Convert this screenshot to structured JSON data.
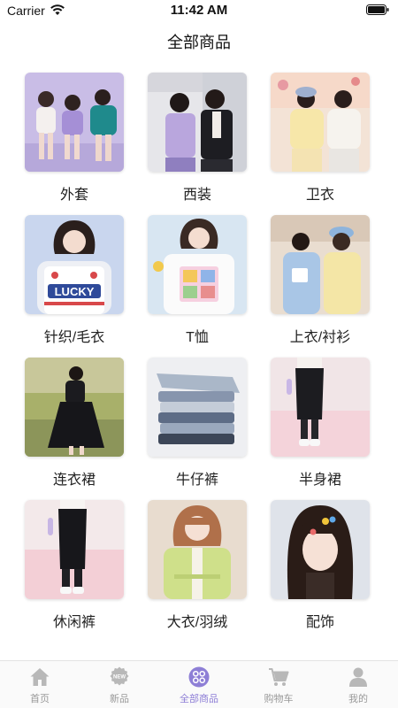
{
  "status": {
    "carrier": "Carrier",
    "time": "11:42 AM"
  },
  "nav": {
    "title": "全部商品"
  },
  "categories": [
    {
      "label": "外套",
      "icon": "photo-outerwear"
    },
    {
      "label": "西装",
      "icon": "photo-suit"
    },
    {
      "label": "卫衣",
      "icon": "photo-hoodie"
    },
    {
      "label": "针织/毛衣",
      "icon": "photo-knitwear",
      "photo_text": "LUCKY"
    },
    {
      "label": "T恤",
      "icon": "photo-tshirt"
    },
    {
      "label": "上衣/衬衫",
      "icon": "photo-shirt"
    },
    {
      "label": "连衣裙",
      "icon": "photo-dress"
    },
    {
      "label": "牛仔裤",
      "icon": "photo-jeans"
    },
    {
      "label": "半身裙",
      "icon": "photo-skirt"
    },
    {
      "label": "休闲裤",
      "icon": "photo-casual-pants"
    },
    {
      "label": "大衣/羽绒",
      "icon": "photo-coat"
    },
    {
      "label": "配饰",
      "icon": "photo-accessories"
    }
  ],
  "tabs": [
    {
      "label": "首页",
      "icon": "home-icon",
      "active": false
    },
    {
      "label": "新品",
      "icon": "new-badge-icon",
      "badge_text": "NEW",
      "active": false
    },
    {
      "label": "全部商品",
      "icon": "all-products-icon",
      "active": true
    },
    {
      "label": "购物车",
      "icon": "cart-icon",
      "active": false
    },
    {
      "label": "我的",
      "icon": "profile-icon",
      "active": false
    }
  ],
  "colors": {
    "accent": "#8e7fd6",
    "tab_inactive": "#999999",
    "tab_icon_inactive": "#b8b8b8"
  }
}
